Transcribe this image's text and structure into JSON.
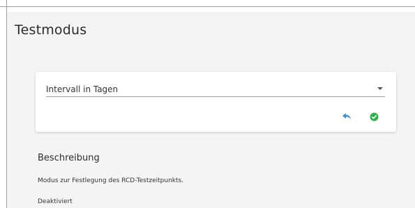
{
  "page": {
    "title": "Testmodus"
  },
  "setting": {
    "select_label": "Intervall in Tagen",
    "icons": {
      "undo": "undo-icon",
      "confirm": "check-circle-icon",
      "dropdown": "chevron-down-icon"
    },
    "colors": {
      "undo": "#3a8fd9",
      "confirm": "#2eb24a"
    }
  },
  "description": {
    "heading": "Beschreibung",
    "text": "Modus zur Festlegung des RCD-Testzeitpunkts.",
    "state": "Deaktiviert"
  }
}
